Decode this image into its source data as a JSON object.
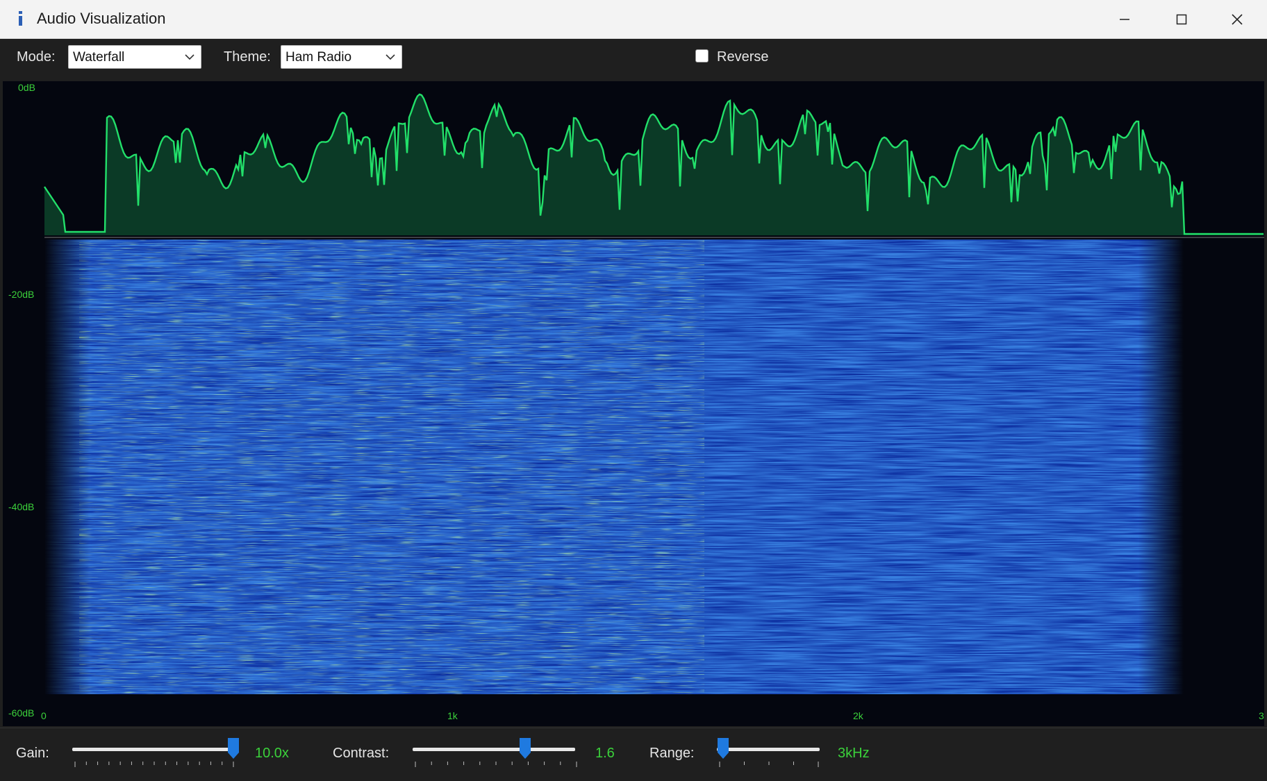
{
  "window": {
    "title": "Audio Visualization"
  },
  "icons": {
    "app": "app-info-icon",
    "minimize": "minimize-icon",
    "maximize": "maximize-icon",
    "close": "close-icon",
    "dropdown": "chevron-down-icon"
  },
  "toolbar": {
    "mode_label": "Mode:",
    "mode_value": "Waterfall",
    "theme_label": "Theme:",
    "theme_value": "Ham Radio",
    "reverse_label": "Reverse",
    "reverse_checked": false
  },
  "visualization": {
    "db_labels": [
      "0dB",
      "-20dB",
      "-40dB",
      "-60dB"
    ],
    "freq_labels": [
      "0",
      "1k",
      "2k",
      "3"
    ],
    "colors": {
      "spectrum_line": "#22e06a",
      "spectrum_fill": "#0b3a26",
      "waterfall_base": "#0a2aa8",
      "background": "#04060f"
    }
  },
  "controls": {
    "gain_label": "Gain:",
    "gain_value": "10.0x",
    "gain_level": 1.0,
    "contrast_label": "Contrast:",
    "contrast_value": "1.6",
    "contrast_level": 0.7,
    "range_label": "Range:",
    "range_value": "3kHz",
    "range_level": 0.0
  }
}
